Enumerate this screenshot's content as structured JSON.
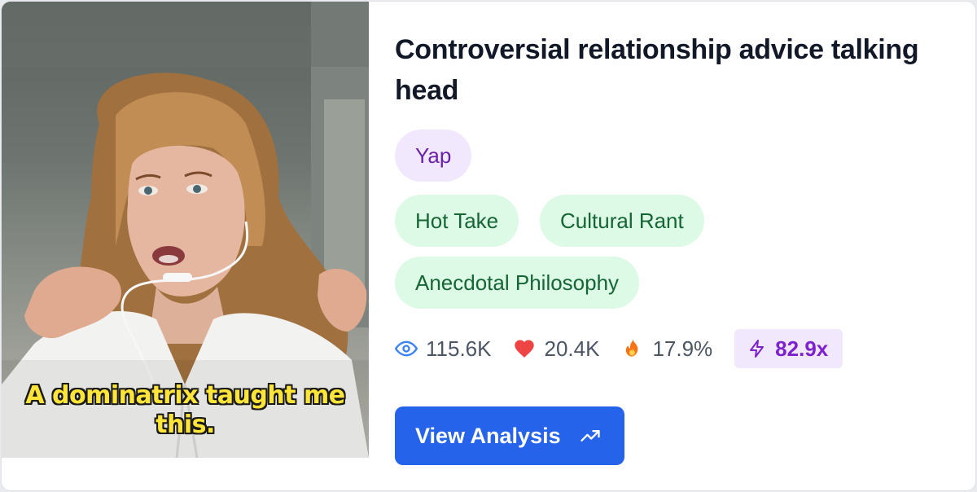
{
  "card": {
    "thumbnail": {
      "caption_line1": "A dominatrix taught me",
      "caption_line2": "this."
    },
    "title": "Controversial relationship advice talking head",
    "format_tag": "Yap",
    "style_tags": [
      "Hot Take",
      "Cultural Rant",
      "Anecdotal Philosophy"
    ],
    "stats": {
      "views": "115.6K",
      "likes": "20.4K",
      "engagement": "17.9%",
      "outlier_score": "82.9x"
    },
    "button_label": "View Analysis"
  },
  "icons": {
    "views": "eye-icon",
    "likes": "heart-icon",
    "engagement": "fire-icon",
    "outlier_score": "lightning-icon",
    "button": "trending-up-icon"
  },
  "colors": {
    "primary": "#2563eb",
    "purple_tag_bg": "#f1e8fd",
    "purple_tag_text": "#6b21a8",
    "green_tag_bg": "#dcfae6",
    "green_tag_text": "#166534",
    "heart": "#ef4444",
    "eye": "#3b82f6"
  }
}
